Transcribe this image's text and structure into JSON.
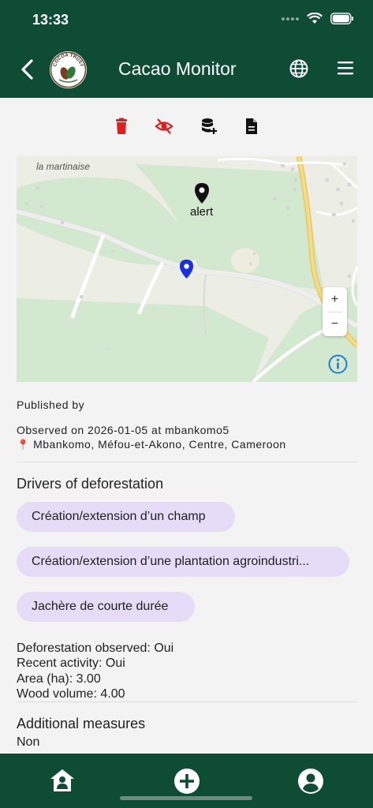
{
  "status": {
    "time": "13:33"
  },
  "header": {
    "title": "Cacao Monitor",
    "logo_text": "COCOA TRUST"
  },
  "map": {
    "place_label": "la martinaise",
    "alert_label": "alert",
    "zoom_in": "+",
    "zoom_out": "−"
  },
  "details": {
    "published_by": "Published by",
    "observed": "Observed on 2026-01-05 at mbankomo5",
    "location_pin": "📍",
    "location": "Mbankomo, Méfou-et-Akono, Centre, Cameroon"
  },
  "drivers": {
    "title": "Drivers of deforestation",
    "chips": [
      "Création/extension d’un champ",
      "Création/extension d’une plantation agroindustri...",
      "Jachère de courte durée"
    ]
  },
  "facts": [
    "Deforestation observed: Oui",
    "Recent activity: Oui",
    "Area (ha): 3.00",
    "Wood volume: 4.00"
  ],
  "additional": {
    "title": "Additional measures",
    "value": "Non"
  },
  "colors": {
    "primary": "#0f4c36",
    "chip": "#e7dcf7",
    "delete": "#e01e1e",
    "marker_blue": "#1a2fe0"
  }
}
